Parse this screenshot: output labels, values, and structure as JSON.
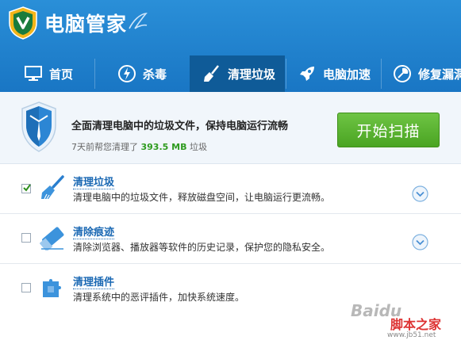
{
  "app": {
    "title": "电脑管家"
  },
  "nav": {
    "tabs": [
      {
        "label": "首页",
        "icon": "monitor-icon"
      },
      {
        "label": "杀毒",
        "icon": "virus-scan-icon"
      },
      {
        "label": "清理垃圾",
        "icon": "broom-icon",
        "active": true
      },
      {
        "label": "电脑加速",
        "icon": "rocket-icon"
      },
      {
        "label": "修复漏洞",
        "icon": "repair-icon"
      }
    ]
  },
  "banner": {
    "title": "全面清理电脑中的垃圾文件，保持电脑运行流畅",
    "sub_prefix": "7天前帮您清理了",
    "sub_size": "393.5 MB",
    "sub_suffix": "垃圾",
    "scan_button": "开始扫描"
  },
  "items": [
    {
      "title": "清理垃圾",
      "desc": "清理电脑中的垃圾文件，释放磁盘空间，让电脑运行更流畅。",
      "checked": true,
      "icon": "broom-icon",
      "expandable": true
    },
    {
      "title": "清除痕迹",
      "desc": "清除浏览器、播放器等软件的历史记录，保护您的隐私安全。",
      "checked": false,
      "icon": "eraser-icon",
      "expandable": true
    },
    {
      "title": "清理插件",
      "desc": "清理系统中的恶评插件，加快系统速度。",
      "checked": false,
      "icon": "puzzle-icon",
      "expandable": false
    }
  ],
  "watermark": {
    "baidu": "Baidu",
    "site": "脚本之家",
    "url": "www.jb51.net"
  },
  "colors": {
    "header": "#1e7fcc",
    "active_tab": "#0f5b98",
    "scan_button": "#5cb532",
    "link": "#1a68b3",
    "size_highlight": "#2e9b1e"
  }
}
